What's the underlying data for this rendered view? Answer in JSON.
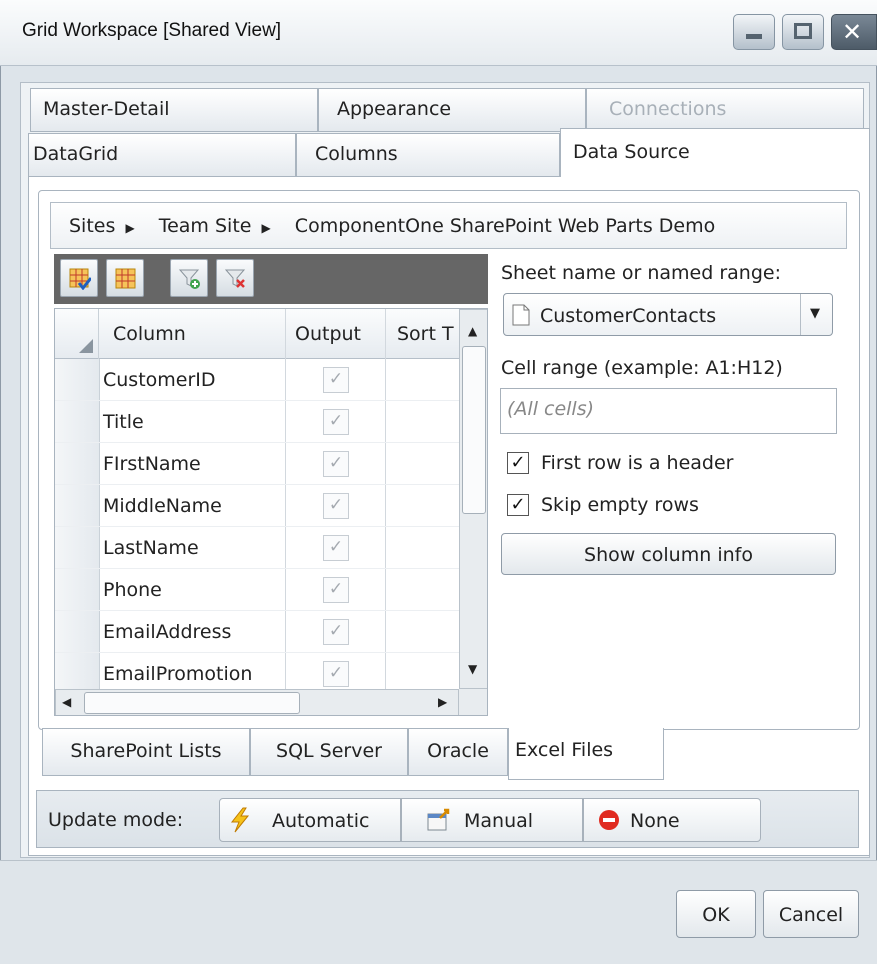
{
  "window": {
    "title": "Grid Workspace [Shared View]"
  },
  "tabs_row1": [
    "Master-Detail",
    "Appearance",
    "Connections"
  ],
  "tabs_row2": [
    "DataGrid",
    "Columns",
    "Data Source"
  ],
  "breadcrumb": [
    "Sites",
    "Team Site",
    "ComponentOne SharePoint Web Parts Demo"
  ],
  "grid": {
    "headers": [
      "Column",
      "Output",
      "Sort T"
    ],
    "rows": [
      {
        "column": "CustomerID",
        "output": true
      },
      {
        "column": "Title",
        "output": true
      },
      {
        "column": "FIrstName",
        "output": true
      },
      {
        "column": "MiddleName",
        "output": true
      },
      {
        "column": "LastName",
        "output": true
      },
      {
        "column": "Phone",
        "output": true
      },
      {
        "column": "EmailAddress",
        "output": true
      },
      {
        "column": "EmailPromotion",
        "output": true
      }
    ]
  },
  "sheet": {
    "label": "Sheet name or named range:",
    "value": "CustomerContacts"
  },
  "cell_range": {
    "label": "Cell range (example: A1:H12)",
    "placeholder": "(All cells)"
  },
  "options": {
    "first_row_header": "First row is a header",
    "first_row_header_checked": true,
    "skip_empty": "Skip empty rows",
    "skip_empty_checked": true,
    "show_column_info": "Show column info"
  },
  "source_tabs": [
    "SharePoint Lists",
    "SQL Server",
    "Oracle",
    "Excel Files"
  ],
  "update_mode": {
    "label": "Update mode:",
    "options": [
      "Automatic",
      "Manual",
      "None"
    ]
  },
  "footer": {
    "ok": "OK",
    "cancel": "Cancel"
  },
  "check_glyph": "✓",
  "arrow_right": "▶"
}
